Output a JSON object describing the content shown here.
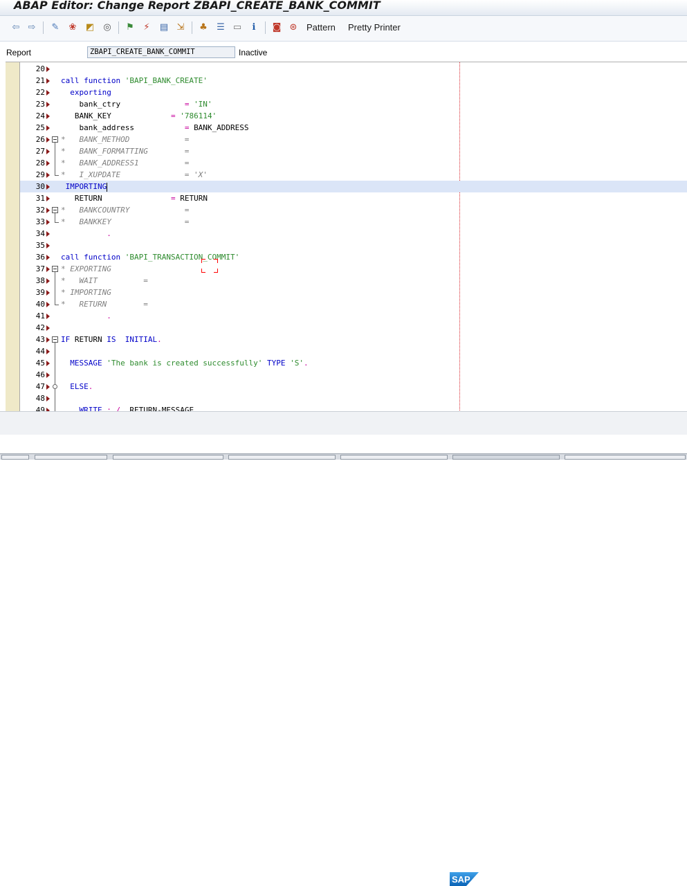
{
  "window": {
    "title": "ABAP Editor: Change Report ZBAPI_CREATE_BANK_COMMIT"
  },
  "toolbar": {
    "icons": [
      "back-icon",
      "forward-icon",
      "other-object-icon",
      "display-change-icon",
      "active-inactive-icon",
      "object-list-icon",
      "check-icon",
      "activate-icon",
      "test-icon",
      "where-used-icon",
      "object-list-display-icon",
      "hierarchy-icon",
      "display-objects-icon",
      "help-icon",
      "breakpoint-icon",
      "external-breakpoint-icon"
    ],
    "pattern_label": "Pattern",
    "pretty_printer_label": "Pretty Printer"
  },
  "header": {
    "report_label": "Report",
    "report_value": "ZBAPI_CREATE_BANK_COMMIT",
    "status": "Inactive"
  },
  "editor": {
    "lines": [
      {
        "n": "20",
        "tokens": []
      },
      {
        "n": "21",
        "tokens": [
          {
            "t": "kw",
            "v": "call function "
          },
          {
            "t": "str",
            "v": "'BAPI_BANK_CREATE'"
          }
        ]
      },
      {
        "n": "22",
        "tokens": [
          {
            "t": "kw",
            "v": "  exporting"
          }
        ]
      },
      {
        "n": "23",
        "tokens": [
          {
            "t": "",
            "v": "    bank_ctry              "
          },
          {
            "t": "pu",
            "v": "= "
          },
          {
            "t": "str",
            "v": "'IN'"
          }
        ]
      },
      {
        "n": "24",
        "tokens": [
          {
            "t": "",
            "v": "   BANK_KEY             "
          },
          {
            "t": "pu",
            "v": "= "
          },
          {
            "t": "str",
            "v": "'786114'"
          }
        ]
      },
      {
        "n": "25",
        "tokens": [
          {
            "t": "",
            "v": "    bank_address           "
          },
          {
            "t": "pu",
            "v": "= "
          },
          {
            "t": "",
            "v": "BANK_ADDRESS"
          }
        ]
      },
      {
        "n": "26",
        "fold": "start",
        "tokens": [
          {
            "t": "cm",
            "v": "*   BANK_METHOD            ="
          }
        ]
      },
      {
        "n": "27",
        "fold": "mid",
        "tokens": [
          {
            "t": "cm",
            "v": "*   BANK_FORMATTING        ="
          }
        ]
      },
      {
        "n": "28",
        "fold": "mid",
        "tokens": [
          {
            "t": "cm",
            "v": "*   BANK_ADDRESS1          ="
          }
        ]
      },
      {
        "n": "29",
        "fold": "end",
        "tokens": [
          {
            "t": "cm",
            "v": "*   I_XUPDATE              = 'X'"
          }
        ]
      },
      {
        "n": "30",
        "hl": true,
        "cursor": true,
        "tokens": [
          {
            "t": "kw",
            "v": " IMPORTING"
          }
        ]
      },
      {
        "n": "31",
        "tokens": [
          {
            "t": "",
            "v": "   RETURN               "
          },
          {
            "t": "pu",
            "v": "= "
          },
          {
            "t": "",
            "v": "RETURN"
          }
        ]
      },
      {
        "n": "32",
        "fold": "start",
        "tokens": [
          {
            "t": "cm",
            "v": "*   BANKCOUNTRY            ="
          }
        ]
      },
      {
        "n": "33",
        "fold": "end",
        "tokens": [
          {
            "t": "cm",
            "v": "*   BANKKEY                ="
          }
        ]
      },
      {
        "n": "34",
        "tokens": [
          {
            "t": "pu",
            "v": "          ."
          }
        ]
      },
      {
        "n": "35",
        "tokens": []
      },
      {
        "n": "36",
        "tokens": [
          {
            "t": "kw",
            "v": "call function "
          },
          {
            "t": "str",
            "v": "'BAPI_TRANSACTION_COMMIT'"
          }
        ]
      },
      {
        "n": "37",
        "fold": "start",
        "tokens": [
          {
            "t": "cm",
            "v": "* EXPORTING"
          }
        ]
      },
      {
        "n": "38",
        "fold": "mid",
        "tokens": [
          {
            "t": "cm",
            "v": "*   WAIT          ="
          }
        ]
      },
      {
        "n": "39",
        "fold": "mid",
        "tokens": [
          {
            "t": "cm",
            "v": "* IMPORTING"
          }
        ]
      },
      {
        "n": "40",
        "fold": "end",
        "tokens": [
          {
            "t": "cm",
            "v": "*   RETURN        ="
          }
        ]
      },
      {
        "n": "41",
        "tokens": [
          {
            "t": "pu",
            "v": "          ."
          }
        ]
      },
      {
        "n": "42",
        "tokens": []
      },
      {
        "n": "43",
        "fold": "start",
        "tokens": [
          {
            "t": "kw",
            "v": "IF "
          },
          {
            "t": "",
            "v": "RETURN "
          },
          {
            "t": "kw",
            "v": "IS  INITIAL"
          },
          {
            "t": "pu",
            "v": "."
          }
        ]
      },
      {
        "n": "44",
        "fold": "mid",
        "tokens": []
      },
      {
        "n": "45",
        "fold": "mid",
        "tokens": [
          {
            "t": "kw",
            "v": "  MESSAGE "
          },
          {
            "t": "str",
            "v": "'The bank is created successfully'"
          },
          {
            "t": "kw",
            "v": " TYPE "
          },
          {
            "t": "str",
            "v": "'S'"
          },
          {
            "t": "pu",
            "v": "."
          }
        ]
      },
      {
        "n": "46",
        "fold": "mid",
        "tokens": []
      },
      {
        "n": "47",
        "fold": "dot",
        "tokens": [
          {
            "t": "kw",
            "v": "  ELSE"
          },
          {
            "t": "pu",
            "v": "."
          }
        ]
      },
      {
        "n": "48",
        "fold": "mid",
        "tokens": []
      },
      {
        "n": "49",
        "fold": "mid",
        "tokens": [
          {
            "t": "kw",
            "v": "    WRITE "
          },
          {
            "t": "pu",
            "v": ": / "
          },
          {
            "t": "",
            "v": " RETURN-MESSAGE"
          },
          {
            "t": "pu",
            "v": "."
          }
        ]
      }
    ]
  },
  "footer": {
    "logo": "SAP"
  },
  "colors": {
    "keyword": "#0000c8",
    "string": "#2e8b2e",
    "comment": "#808080",
    "punct": "#c8009c",
    "highlight": "#dbe5f7"
  }
}
